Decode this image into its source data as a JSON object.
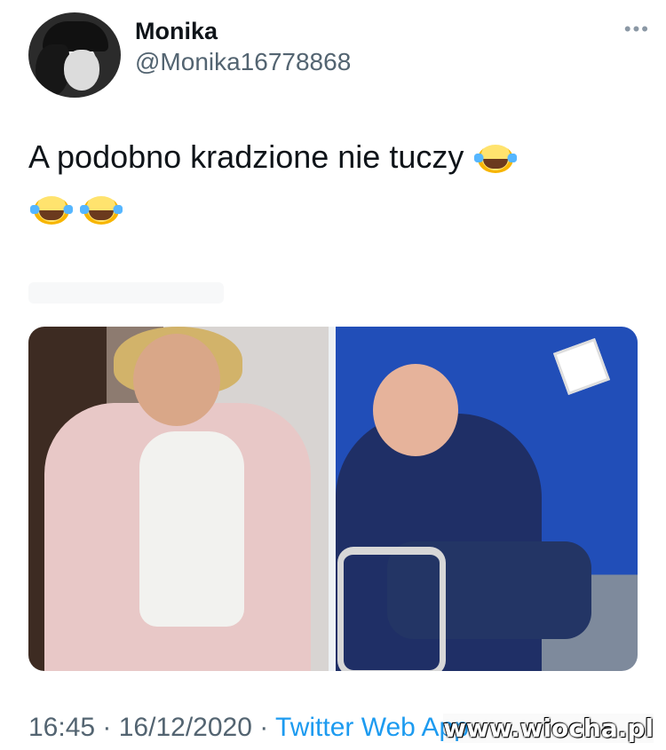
{
  "tweet": {
    "display_name": "Monika",
    "handle": "@Monika16778868",
    "text": "A podobno kradzione nie tuczy",
    "emoji_line": "",
    "time": "16:45",
    "date": "16/12/2020",
    "separator": " · ",
    "app": "Twitter Web App"
  },
  "watermark": "www.wiocha.pl",
  "icons": {
    "avatar": "avatar-photo",
    "more": "ellipsis-icon",
    "emoji": "laughing-tears-emoji"
  },
  "colors": {
    "accent": "#1d9bf0",
    "secondary_text": "#536471",
    "text": "#0f1419",
    "background": "#ffffff"
  }
}
